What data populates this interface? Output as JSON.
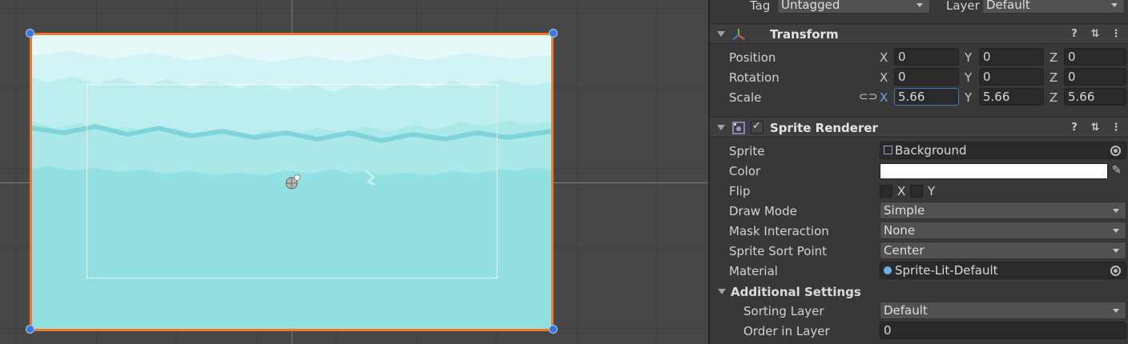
{
  "header_top": {
    "tag_label": "Tag",
    "tag_value": "Untagged",
    "layer_label": "Layer",
    "layer_value": "Default"
  },
  "transform": {
    "title": "Transform",
    "position": {
      "label": "Position",
      "x": "0",
      "y": "0",
      "z": "0"
    },
    "rotation": {
      "label": "Rotation",
      "x": "0",
      "y": "0",
      "z": "0"
    },
    "scale": {
      "label": "Scale",
      "x": "5.66",
      "y": "5.66",
      "z": "5.66"
    },
    "axis_x": "X",
    "axis_y": "Y",
    "axis_z": "Z"
  },
  "sprite_renderer": {
    "title": "Sprite Renderer",
    "enabled": true,
    "sprite": {
      "label": "Sprite",
      "value": "Background"
    },
    "color": {
      "label": "Color",
      "value": "#ffffff"
    },
    "flip": {
      "label": "Flip",
      "x": "X",
      "y": "Y"
    },
    "draw_mode": {
      "label": "Draw Mode",
      "value": "Simple"
    },
    "mask_interaction": {
      "label": "Mask Interaction",
      "value": "None"
    },
    "sort_point": {
      "label": "Sprite Sort Point",
      "value": "Center"
    },
    "material": {
      "label": "Material",
      "value": "Sprite-Lit-Default"
    },
    "additional": {
      "title": "Additional Settings",
      "sorting_layer": {
        "label": "Sorting Layer",
        "value": "Default"
      },
      "order_in_layer": {
        "label": "Order in Layer",
        "value": "0"
      }
    }
  },
  "icons": {
    "help": "help-icon",
    "presets": "presets-icon",
    "menu": "kebab-menu-icon"
  },
  "colors": {
    "selection_outline": "#f0782a",
    "handle": "#3a78e0",
    "sky": "#93e0e3",
    "focus": "#3a79bb"
  }
}
